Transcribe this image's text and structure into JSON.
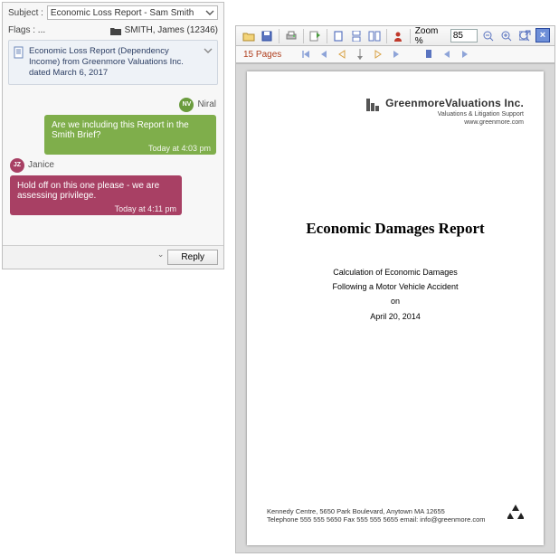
{
  "panel": {
    "subject_label": "Subject :",
    "subject_value": "Economic Loss Report - Sam Smith",
    "flags_label": "Flags :",
    "flags_value": "...",
    "owner": "SMITH, James (12346)",
    "attachment": "Economic Loss Report (Dependency Income) from Greenmore Valuations Inc. dated March 6, 2017",
    "reply_label": "Reply"
  },
  "thread": {
    "msg1_user": "Niral",
    "msg1_av": "NV",
    "msg1_text": "Are we including this Report in the Smith Brief?",
    "msg1_time": "Today at 4:03 pm",
    "msg2_user": "Janice",
    "msg2_av": "JZ",
    "msg2_text": "Hold off on this one please - we are assessing privilege.",
    "msg2_time": "Today at 4:11 pm"
  },
  "toolbar": {
    "zoom_label": "Zoom %",
    "zoom_value": "85"
  },
  "pagesbar": {
    "count": "15 Pages"
  },
  "doc": {
    "company": "GreenmoreValuations Inc.",
    "tagline": "Valuations & Litigation Support",
    "url": "www.greenmore.com",
    "title": "Economic Damages Report",
    "line1": "Calculation of Economic Damages",
    "line2": "Following a Motor Vehicle Accident",
    "line3": "on",
    "line4": "April 20, 2014",
    "footer1": "Kennedy Centre, 5650 Park Boulevard, Anytown MA 12655",
    "footer2": "Telephone 555 555 5650  Fax 555 555 5655  email: info@greenmore.com"
  }
}
